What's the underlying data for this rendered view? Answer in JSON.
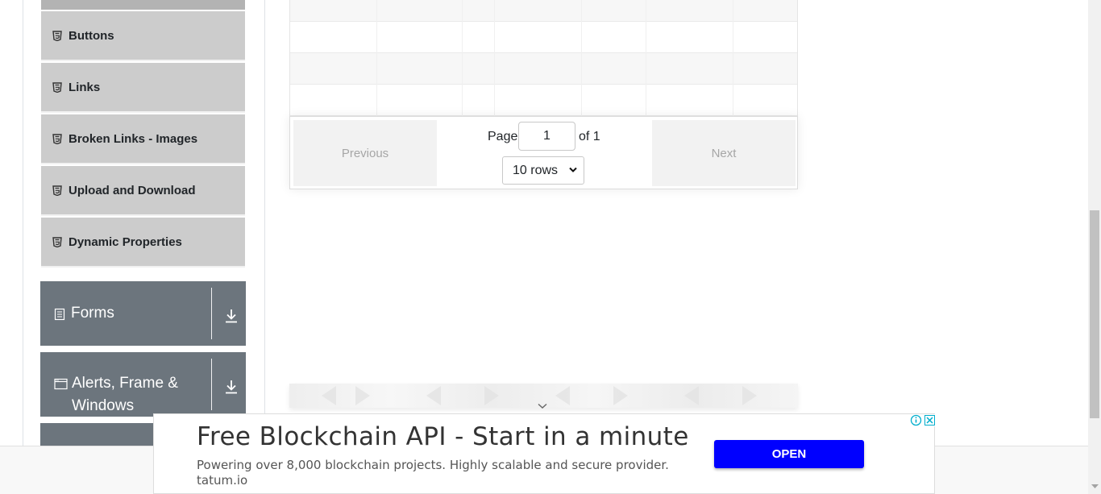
{
  "sidebar": {
    "elements_items": [
      {
        "label": "Buttons",
        "icon": "html5-icon"
      },
      {
        "label": "Links",
        "icon": "html5-icon"
      },
      {
        "label": "Broken Links - Images",
        "icon": "html5-icon"
      },
      {
        "label": "Upload and Download",
        "icon": "html5-icon"
      },
      {
        "label": "Dynamic Properties",
        "icon": "html5-icon"
      }
    ],
    "groups": [
      {
        "label": "Forms",
        "icon": "form-icon",
        "toggle_icon": "download-arrow-icon"
      },
      {
        "label_line1": "Alerts, Frame &",
        "label_line2": "Windows",
        "icon": "window-icon",
        "toggle_icon": "download-arrow-icon"
      }
    ]
  },
  "table": {
    "rows_visible": 4
  },
  "pagination": {
    "previous_label": "Previous",
    "next_label": "Next",
    "page_label": "Page",
    "page_value": "1",
    "of_label": "of 1",
    "rows_selected": "10 rows"
  },
  "ad": {
    "title": "Free Blockchain API - Start in a minute",
    "description": "Powering over 8,000 blockchain projects. Highly scalable and secure provider.",
    "url": "tatum.io",
    "button_label": "OPEN",
    "button_color": "#0000ff"
  },
  "colors": {
    "sidebar_item_bg": "#cccccc",
    "group_bg": "#6c757d"
  }
}
